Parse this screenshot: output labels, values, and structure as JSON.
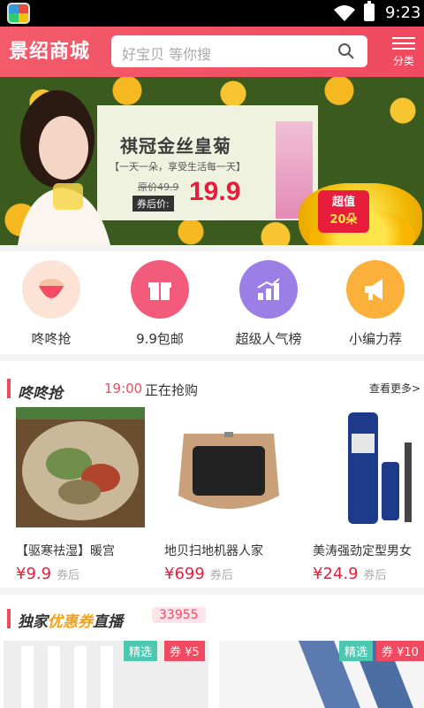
{
  "status_bar": {
    "time": "9:23"
  },
  "header": {
    "logo": "景绍商城",
    "search_placeholder": "好宝贝 等你搜",
    "menu_label": "分类"
  },
  "banner": {
    "title": "祺冠金丝皇菊",
    "subtitle": "【一天一朵，享受生活每一天】",
    "original_price": "原价49.9",
    "after_coupon_label": "券后价:",
    "price": "19.9",
    "tag_line1": "超值",
    "tag_line2": "20朵"
  },
  "categories": [
    {
      "label": "咚咚抢",
      "icon": "drum-icon",
      "color": "#fde3d6"
    },
    {
      "label": "9.9包邮",
      "icon": "gift-icon",
      "color": "#f35b7a"
    },
    {
      "label": "超级人气榜",
      "icon": "chart-up-icon",
      "color": "#9b7fe6"
    },
    {
      "label": "小编力荐",
      "icon": "megaphone-icon",
      "color": "#fbb03b"
    }
  ],
  "flash_sale": {
    "title": "咚咚抢",
    "time": "19:00",
    "status": "正在抢购",
    "more": "查看更多>",
    "products": [
      {
        "name": "【驱寒祛湿】暖宫",
        "price": "¥9.9",
        "coupon": "券后"
      },
      {
        "name": "地贝扫地机器人家",
        "price": "¥699",
        "coupon": "券后"
      },
      {
        "name": "美涛强劲定型男女",
        "price": "¥24.9",
        "coupon": "券后"
      }
    ]
  },
  "coupon_live": {
    "title_prefix": "独家",
    "title_highlight": "优惠券",
    "title_suffix": "直播",
    "count": "33955",
    "cards": [
      {
        "tag": "精选",
        "coupon": "券 ¥5"
      },
      {
        "tag": "精选",
        "coupon": "券 ¥10"
      }
    ]
  }
}
